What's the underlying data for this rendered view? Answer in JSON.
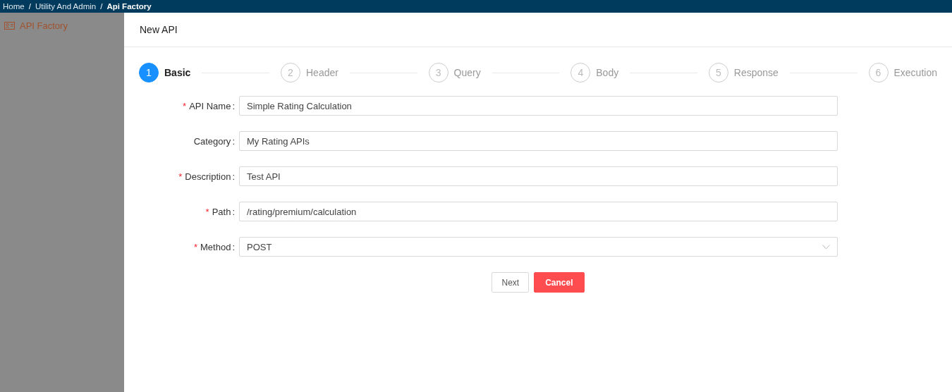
{
  "breadcrumb": [
    {
      "label": "Home",
      "selected": false
    },
    {
      "label": "Utility And Admin",
      "selected": false
    },
    {
      "label": "Api Factory",
      "selected": true
    }
  ],
  "breadcrumb_separator": "/",
  "sidebar": {
    "items": [
      {
        "label": "API Factory"
      }
    ]
  },
  "drawer": {
    "title": "New API",
    "steps": [
      {
        "number": "1",
        "label": "Basic",
        "selected": true
      },
      {
        "number": "2",
        "label": "Header",
        "selected": false
      },
      {
        "number": "3",
        "label": "Query",
        "selected": false
      },
      {
        "number": "4",
        "label": "Body",
        "selected": false
      },
      {
        "number": "5",
        "label": "Response",
        "selected": false
      },
      {
        "number": "6",
        "label": "Execution",
        "selected": false
      }
    ],
    "fields": [
      {
        "label": "API Name",
        "required": true,
        "kind": "input",
        "value": "Simple Rating Calculation"
      },
      {
        "label": "Category",
        "required": false,
        "kind": "input",
        "value": "My Rating APIs"
      },
      {
        "label": "Description",
        "required": true,
        "kind": "input",
        "value": "Test API"
      },
      {
        "label": "Path",
        "required": true,
        "kind": "input",
        "value": "/rating/premium/calculation"
      },
      {
        "label": "Method",
        "required": true,
        "kind": "select",
        "value": "POST"
      }
    ],
    "required_mark": "*",
    "label_suffix": ":",
    "buttons": [
      {
        "label": "Next",
        "kind": "default"
      },
      {
        "label": "Cancel",
        "kind": "danger"
      }
    ]
  }
}
